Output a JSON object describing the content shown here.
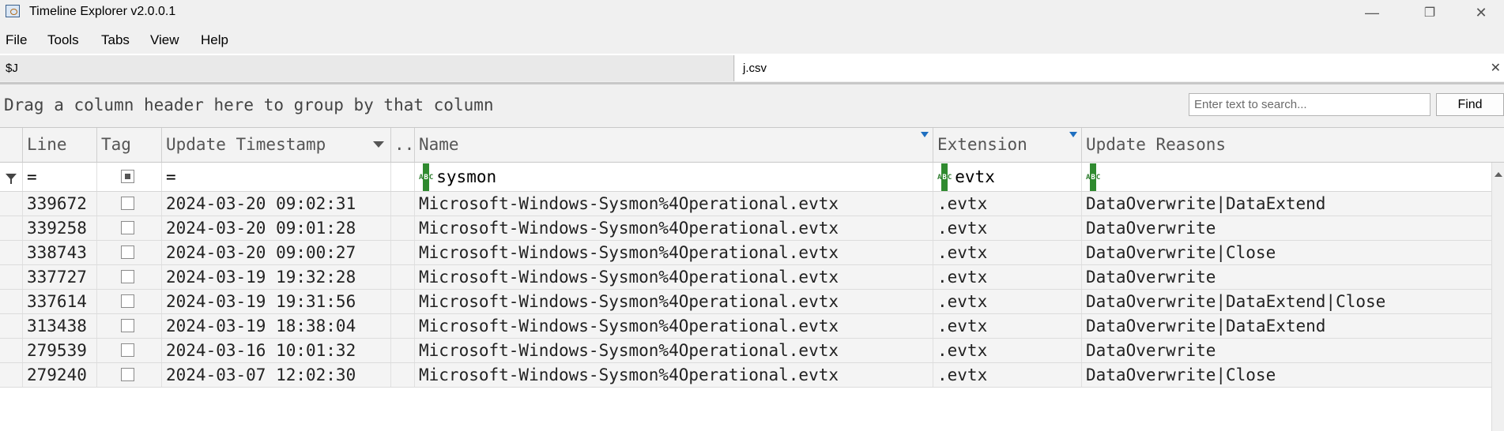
{
  "window": {
    "title": "Timeline Explorer v2.0.0.1",
    "minimize": "—",
    "restore": "❐",
    "close": "✕"
  },
  "menu": [
    "File",
    "Tools",
    "Tabs",
    "View",
    "Help"
  ],
  "tabs": [
    {
      "label": "$J",
      "active": false
    },
    {
      "label": "j.csv",
      "active": true,
      "close": "✕"
    }
  ],
  "group_panel": {
    "hint": "Drag a column header here to group by that column"
  },
  "search": {
    "placeholder": "Enter text to search...",
    "value": "",
    "button": "Find"
  },
  "grid": {
    "columns": [
      "Line",
      "Tag",
      "Update Timestamp",
      "...",
      "Name",
      "Extension",
      "Update Reasons"
    ],
    "filters": {
      "line": "=",
      "timestamp": "=",
      "name": "sysmon",
      "extension": "evtx",
      "update_reasons": ""
    },
    "rows": [
      {
        "line": "339672",
        "timestamp": "2024-03-20 09:02:31",
        "name": "Microsoft-Windows-Sysmon%4Operational.evtx",
        "extension": ".evtx",
        "reasons": "DataOverwrite|DataExtend"
      },
      {
        "line": "339258",
        "timestamp": "2024-03-20 09:01:28",
        "name": "Microsoft-Windows-Sysmon%4Operational.evtx",
        "extension": ".evtx",
        "reasons": "DataOverwrite"
      },
      {
        "line": "338743",
        "timestamp": "2024-03-20 09:00:27",
        "name": "Microsoft-Windows-Sysmon%4Operational.evtx",
        "extension": ".evtx",
        "reasons": "DataOverwrite|Close"
      },
      {
        "line": "337727",
        "timestamp": "2024-03-19 19:32:28",
        "name": "Microsoft-Windows-Sysmon%4Operational.evtx",
        "extension": ".evtx",
        "reasons": "DataOverwrite"
      },
      {
        "line": "337614",
        "timestamp": "2024-03-19 19:31:56",
        "name": "Microsoft-Windows-Sysmon%4Operational.evtx",
        "extension": ".evtx",
        "reasons": "DataOverwrite|DataExtend|Close"
      },
      {
        "line": "313438",
        "timestamp": "2024-03-19 18:38:04",
        "name": "Microsoft-Windows-Sysmon%4Operational.evtx",
        "extension": ".evtx",
        "reasons": "DataOverwrite|DataExtend"
      },
      {
        "line": "279539",
        "timestamp": "2024-03-16 10:01:32",
        "name": "Microsoft-Windows-Sysmon%4Operational.evtx",
        "extension": ".evtx",
        "reasons": "DataOverwrite"
      },
      {
        "line": "279240",
        "timestamp": "2024-03-07 12:02:30",
        "name": "Microsoft-Windows-Sysmon%4Operational.evtx",
        "extension": ".evtx",
        "reasons": "DataOverwrite|Close"
      }
    ]
  }
}
